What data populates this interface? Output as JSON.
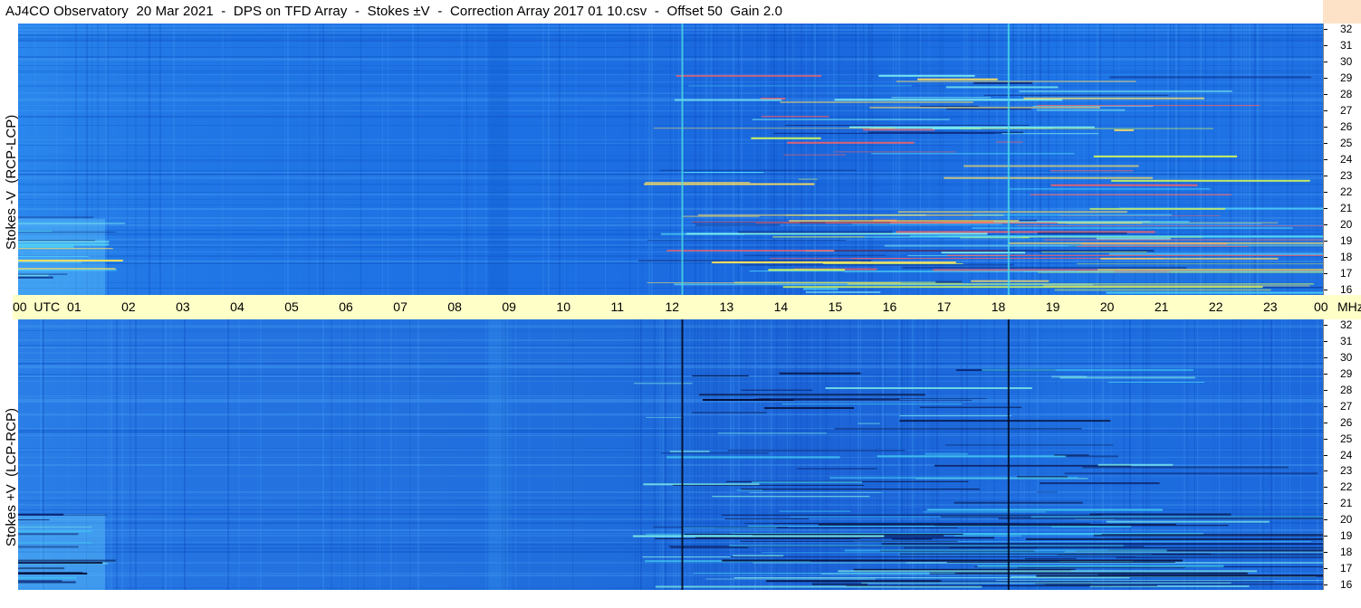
{
  "title": "AJ4CO Observatory  20 Mar 2021  -  DPS on TFD Array  -  Stokes ±V  -  Correction Array 2017 01 10.csv  -  Offset 50  Gain 2.0",
  "colors": {
    "panel_base": "#1a6ee0",
    "time_axis_bg": "#ffffc8",
    "right_strip_bg": "#fde2c8"
  },
  "chart_data": {
    "type": "heatmap",
    "panels": [
      {
        "name": "Stokes -V (RCP-LCP)",
        "ylabel": "Stokes -V  (RCP-LCP)",
        "y_ticks": [
          "32",
          "31",
          "30",
          "29",
          "28",
          "27",
          "26",
          "25",
          "24",
          "23",
          "22",
          "21",
          "20",
          "19",
          "18",
          "17",
          "16"
        ],
        "ylim": [
          16,
          32
        ]
      },
      {
        "name": "Stokes +V (LCP-RCP)",
        "ylabel": "Stokes +V  (LCP-RCP)",
        "y_ticks": [
          "32",
          "31",
          "30",
          "29",
          "28",
          "27",
          "26",
          "25",
          "24",
          "23",
          "22",
          "21",
          "20",
          "19",
          "18",
          "17",
          "16"
        ],
        "ylim": [
          16,
          32
        ]
      }
    ],
    "x_ticks": [
      "00  UTC",
      "01",
      "02",
      "03",
      "04",
      "05",
      "06",
      "07",
      "08",
      "09",
      "10",
      "11",
      "12",
      "13",
      "14",
      "15",
      "16",
      "17",
      "18",
      "19",
      "20",
      "21",
      "22",
      "23",
      "00"
    ],
    "xlim": [
      0,
      24
    ],
    "x_unit": "UTC",
    "y_unit": "MHz",
    "vertical_markers_utc": [
      12.2,
      18.2
    ]
  }
}
